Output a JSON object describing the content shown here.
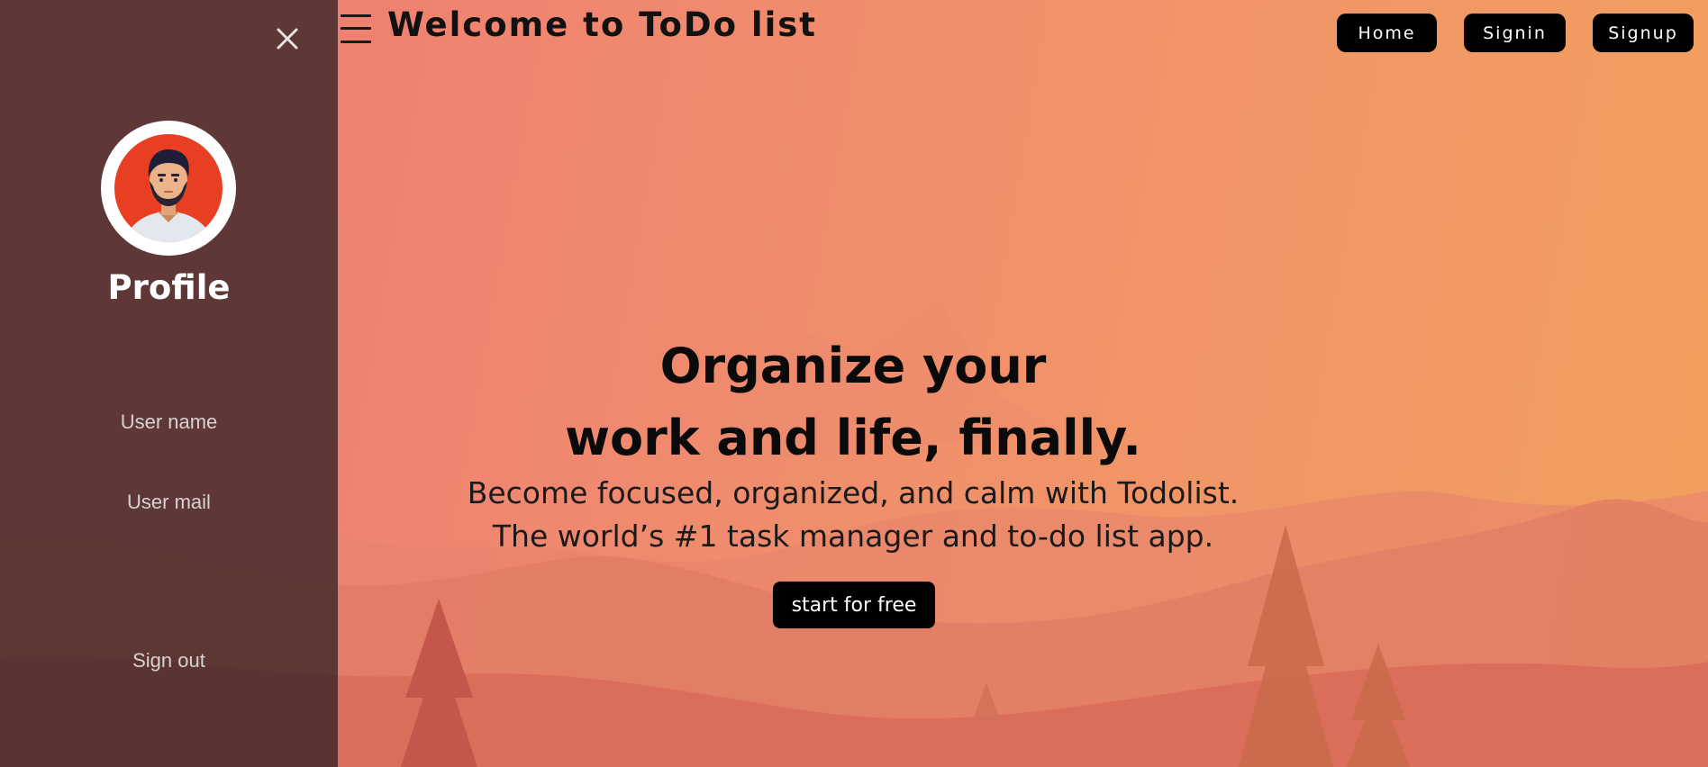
{
  "header": {
    "title": "Welcome to ToDo list",
    "nav": {
      "home": "Home",
      "signin": "Signin",
      "signup": "Signup"
    }
  },
  "hero": {
    "title_line1": "Organize your",
    "title_line2": "work and life, finally.",
    "subtitle_line1": "Become focused, organized, and calm with Todolist.",
    "subtitle_line2": "The world’s #1 task manager and to-do list app.",
    "cta_label": "start for free"
  },
  "sidebar": {
    "close_icon": "close-icon",
    "profile_title": "Profile",
    "user_name": "User name",
    "user_mail": "User mail",
    "sign_out": "Sign out"
  },
  "colors": {
    "sidebar_bg": "#3a2628",
    "button_bg": "#000000",
    "gradient_left": "#ec7870",
    "gradient_right": "#f1a05e"
  }
}
